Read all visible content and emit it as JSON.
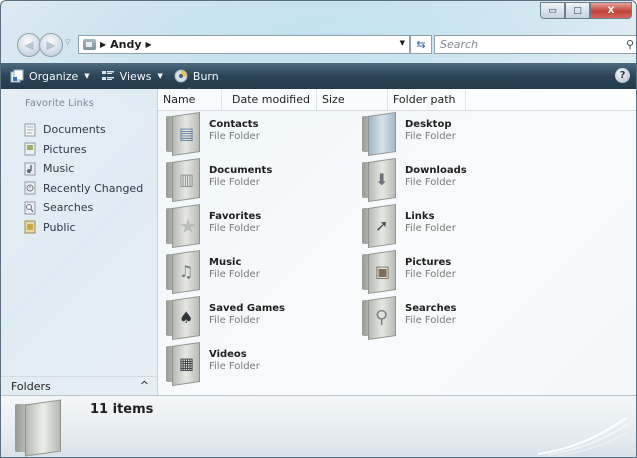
{
  "address": {
    "crumbs": [
      "Andy"
    ],
    "search_placeholder": "Search"
  },
  "caption_buttons": {
    "minimize": "▭",
    "maximize": "□",
    "close": "X"
  },
  "toolbar": {
    "organize": "Organize",
    "views": "Views",
    "burn": "Burn",
    "help": "?"
  },
  "nav": {
    "heading": "Favorite Links",
    "items": [
      {
        "label": "Documents",
        "icon": "documents-icon"
      },
      {
        "label": "Pictures",
        "icon": "pictures-icon"
      },
      {
        "label": "Music",
        "icon": "music-icon"
      },
      {
        "label": "Recently Changed",
        "icon": "recently-changed-icon"
      },
      {
        "label": "Searches",
        "icon": "searches-icon"
      },
      {
        "label": "Public",
        "icon": "public-icon"
      }
    ],
    "folders_label": "Folders"
  },
  "columns": [
    "Name",
    "Date modified",
    "Size",
    "Folder path"
  ],
  "items": [
    {
      "name": "Contacts",
      "type": "File Folder",
      "icon": "contacts-folder-icon"
    },
    {
      "name": "Desktop",
      "type": "File Folder",
      "icon": "desktop-folder-icon"
    },
    {
      "name": "Documents",
      "type": "File Folder",
      "icon": "documents-folder-icon"
    },
    {
      "name": "Downloads",
      "type": "File Folder",
      "icon": "downloads-folder-icon"
    },
    {
      "name": "Favorites",
      "type": "File Folder",
      "icon": "favorites-folder-icon"
    },
    {
      "name": "Links",
      "type": "File Folder",
      "icon": "links-folder-icon"
    },
    {
      "name": "Music",
      "type": "File Folder",
      "icon": "music-folder-icon"
    },
    {
      "name": "Pictures",
      "type": "File Folder",
      "icon": "pictures-folder-icon"
    },
    {
      "name": "Saved Games",
      "type": "File Folder",
      "icon": "saved-games-folder-icon"
    },
    {
      "name": "Searches",
      "type": "File Folder",
      "icon": "searches-folder-icon"
    },
    {
      "name": "Videos",
      "type": "File Folder",
      "icon": "videos-folder-icon"
    }
  ],
  "details": {
    "count": "11 items"
  }
}
